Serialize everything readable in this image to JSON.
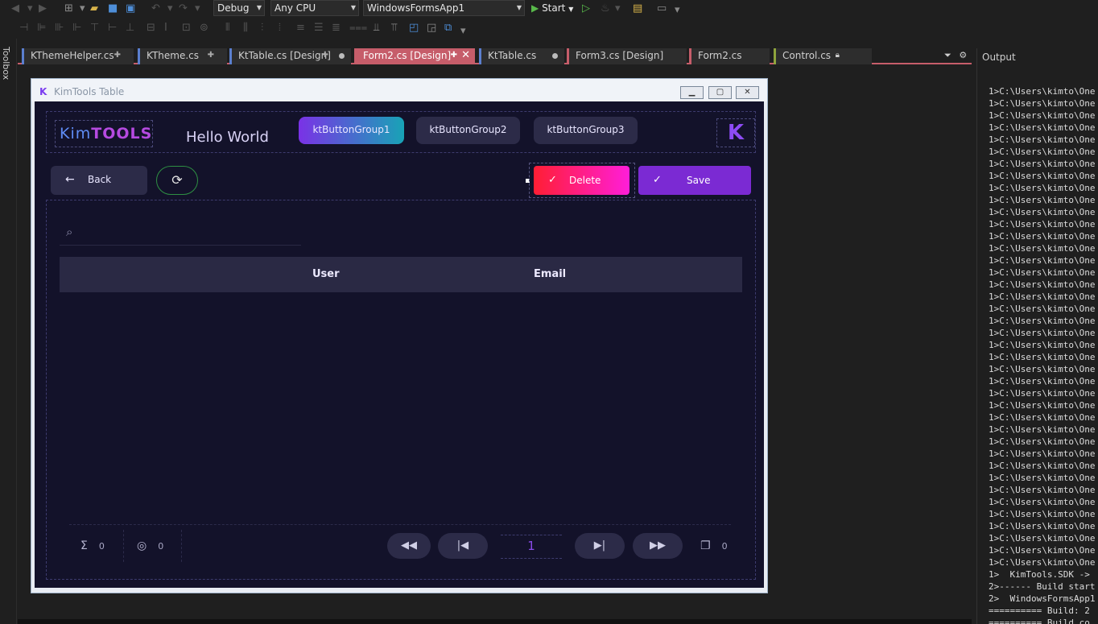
{
  "toolbar": {
    "config": "Debug",
    "platform": "Any CPU",
    "startup_project": "WindowsFormsApp1",
    "start_label": "Start"
  },
  "toolbox": {
    "label": "Toolbox"
  },
  "tabs": [
    {
      "label": "KThemeHelper.cs",
      "accent": "#5b7fcf"
    },
    {
      "label": "KTheme.cs",
      "accent": "#5b7fcf"
    },
    {
      "label": "KtTable.cs [Design]",
      "accent": "#5b7fcf"
    },
    {
      "label": "Form2.cs [Design]",
      "accent": "#c65d6a"
    },
    {
      "label": "KtTable.cs",
      "accent": "#5b7fcf"
    },
    {
      "label": "Form3.cs [Design]",
      "accent": "#c65d6a"
    },
    {
      "label": "Form2.cs",
      "accent": "#c65d6a"
    },
    {
      "label": "Control.cs",
      "accent": "#8fa43c"
    }
  ],
  "output": {
    "title": "Output",
    "lines": [
      "1>C:\\Users\\kimto\\One",
      "1>C:\\Users\\kimto\\One",
      "1>C:\\Users\\kimto\\One",
      "1>C:\\Users\\kimto\\One",
      "1>C:\\Users\\kimto\\One",
      "1>C:\\Users\\kimto\\One",
      "1>C:\\Users\\kimto\\One",
      "1>C:\\Users\\kimto\\One",
      "1>C:\\Users\\kimto\\One",
      "1>C:\\Users\\kimto\\One",
      "1>C:\\Users\\kimto\\One",
      "1>C:\\Users\\kimto\\One",
      "1>C:\\Users\\kimto\\One",
      "1>C:\\Users\\kimto\\One",
      "1>C:\\Users\\kimto\\One",
      "1>C:\\Users\\kimto\\One",
      "1>C:\\Users\\kimto\\One",
      "1>C:\\Users\\kimto\\One",
      "1>C:\\Users\\kimto\\One",
      "1>C:\\Users\\kimto\\One",
      "1>C:\\Users\\kimto\\One",
      "1>C:\\Users\\kimto\\One",
      "1>C:\\Users\\kimto\\One",
      "1>C:\\Users\\kimto\\One",
      "1>C:\\Users\\kimto\\One",
      "1>C:\\Users\\kimto\\One",
      "1>C:\\Users\\kimto\\One",
      "1>C:\\Users\\kimto\\One",
      "1>C:\\Users\\kimto\\One",
      "1>C:\\Users\\kimto\\One",
      "1>C:\\Users\\kimto\\One",
      "1>C:\\Users\\kimto\\One",
      "1>C:\\Users\\kimto\\One",
      "1>C:\\Users\\kimto\\One",
      "1>C:\\Users\\kimto\\One",
      "1>C:\\Users\\kimto\\One",
      "1>C:\\Users\\kimto\\One",
      "1>C:\\Users\\kimto\\One",
      "1>C:\\Users\\kimto\\One",
      "1>C:\\Users\\kimto\\One",
      "1>  KimTools.SDK ->",
      "2>------ Build start",
      "2>  WindowsFormsApp1",
      "========== Build: 2",
      "========== Build co"
    ]
  },
  "form": {
    "title": "KimTools Table",
    "brand_kim": "Kim",
    "brand_tools": "TOOLS",
    "hello": "Hello World",
    "groups": [
      "ktButtonGroup1",
      "ktButtonGroup2",
      "ktButtonGroup3"
    ],
    "back_label": "Back",
    "delete_label": "Delete",
    "save_label": "Save",
    "search_placeholder": "",
    "columns": [
      "User",
      "Email"
    ],
    "total_count": "0",
    "checked_count": "0",
    "current_page": "1",
    "page_count": "0"
  }
}
